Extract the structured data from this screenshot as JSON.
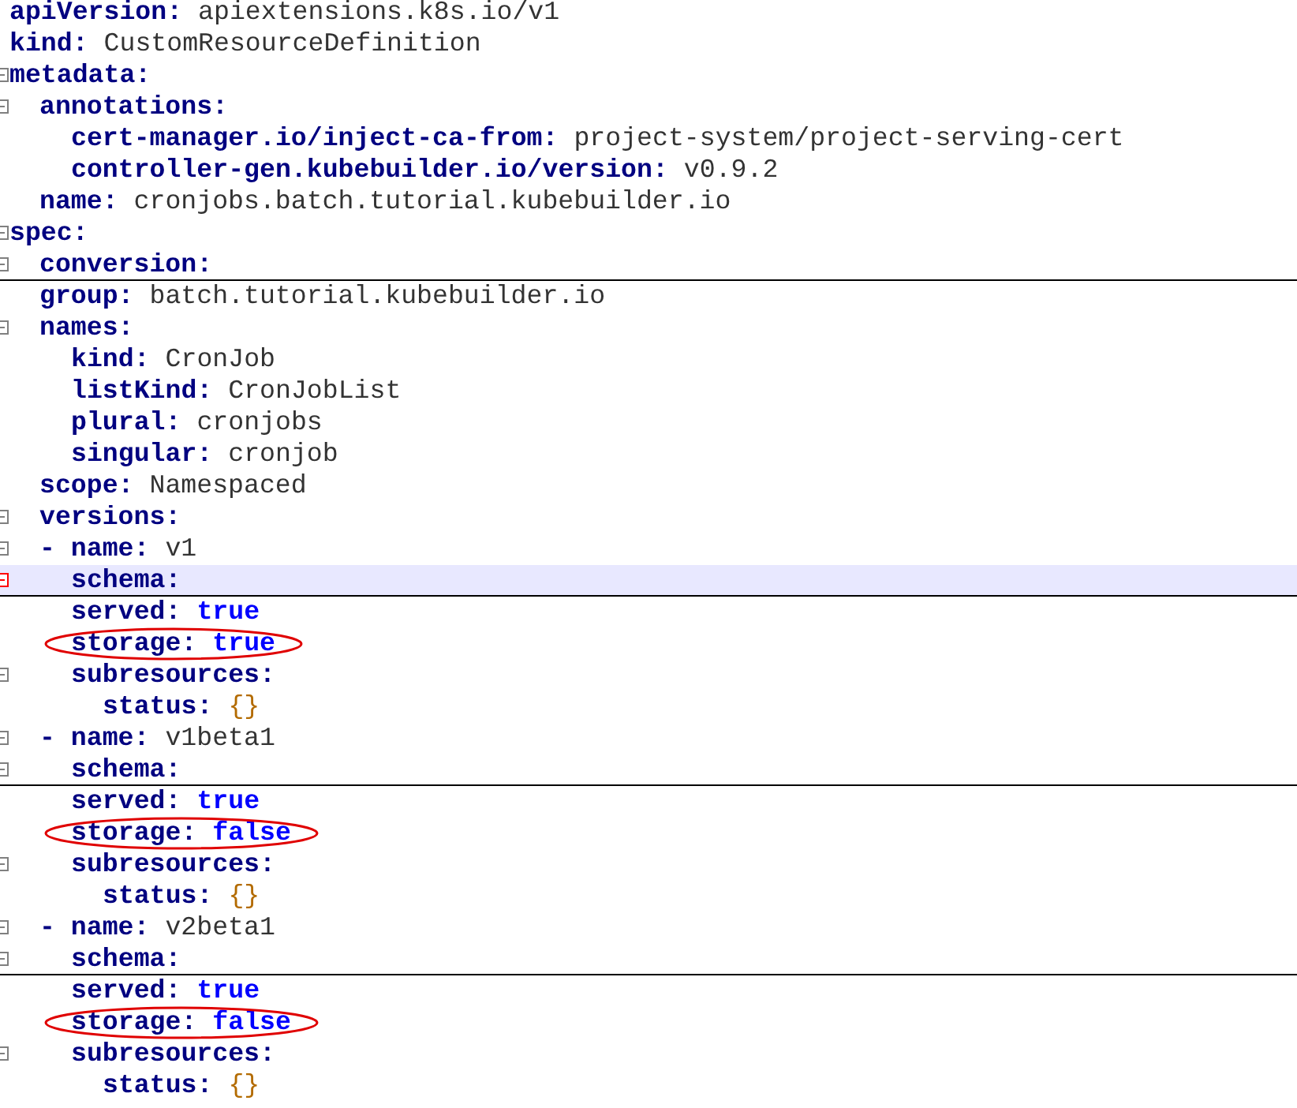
{
  "lines": [
    {
      "key": "apiVersion:",
      "value": "apiextensions.k8s.io/v1",
      "kind": "scalar"
    },
    {
      "key": "kind:",
      "value": "CustomResourceDefinition",
      "kind": "scalar"
    },
    {
      "key": "metadata:",
      "children": [
        {
          "key": "annotations:",
          "children": [
            {
              "key": "cert-manager.io/inject-ca-from:",
              "value": "project-system/project-serving-cert",
              "kind": "scalar"
            },
            {
              "key": "controller-gen.kubebuilder.io/version:",
              "value": "v0.9.2",
              "kind": "scalar"
            }
          ]
        },
        {
          "key": "name:",
          "value": "cronjobs.batch.tutorial.kubebuilder.io",
          "kind": "scalar"
        }
      ]
    },
    {
      "key": "spec:",
      "children": [
        {
          "key": "conversion:",
          "folded": true
        },
        {
          "key": "group:",
          "value": "batch.tutorial.kubebuilder.io",
          "kind": "scalar"
        },
        {
          "key": "names:",
          "children": [
            {
              "key": "kind:",
              "value": "CronJob",
              "kind": "scalar"
            },
            {
              "key": "listKind:",
              "value": "CronJobList",
              "kind": "scalar"
            },
            {
              "key": "plural:",
              "value": "cronjobs",
              "kind": "scalar"
            },
            {
              "key": "singular:",
              "value": "cronjob",
              "kind": "scalar"
            }
          ]
        },
        {
          "key": "scope:",
          "value": "Namespaced",
          "kind": "scalar"
        },
        {
          "key": "versions:",
          "children": [
            {
              "key": "- name:",
              "value": "v1",
              "kind": "scalar",
              "list_item": true,
              "children": [
                {
                  "key": "schema:",
                  "folded": true,
                  "current": true
                },
                {
                  "key": "served:",
                  "value": "true",
                  "kind": "boolean"
                },
                {
                  "key": "storage:",
                  "value": "true",
                  "kind": "boolean",
                  "circled": true
                },
                {
                  "key": "subresources:",
                  "children": [
                    {
                      "key": "status:",
                      "value": "{}",
                      "kind": "mapping"
                    }
                  ]
                }
              ]
            },
            {
              "key": "- name:",
              "value": "v1beta1",
              "kind": "scalar",
              "list_item": true,
              "children": [
                {
                  "key": "schema:",
                  "folded": true,
                  "current": false
                },
                {
                  "key": "served:",
                  "value": "true",
                  "kind": "boolean"
                },
                {
                  "key": "storage:",
                  "value": "false",
                  "kind": "boolean",
                  "circled": true
                },
                {
                  "key": "subresources:",
                  "children": [
                    {
                      "key": "status:",
                      "value": "{}",
                      "kind": "mapping"
                    }
                  ]
                }
              ]
            },
            {
              "key": "- name:",
              "value": "v2beta1",
              "kind": "scalar",
              "list_item": true,
              "children": [
                {
                  "key": "schema:",
                  "folded": true,
                  "current": false
                },
                {
                  "key": "served:",
                  "value": "true",
                  "kind": "boolean"
                },
                {
                  "key": "storage:",
                  "value": "false",
                  "kind": "boolean",
                  "circled": true
                },
                {
                  "key": "subresources:",
                  "children": [
                    {
                      "key": "status:",
                      "value": "{}",
                      "kind": "mapping"
                    }
                  ]
                }
              ]
            }
          ]
        }
      ]
    }
  ]
}
